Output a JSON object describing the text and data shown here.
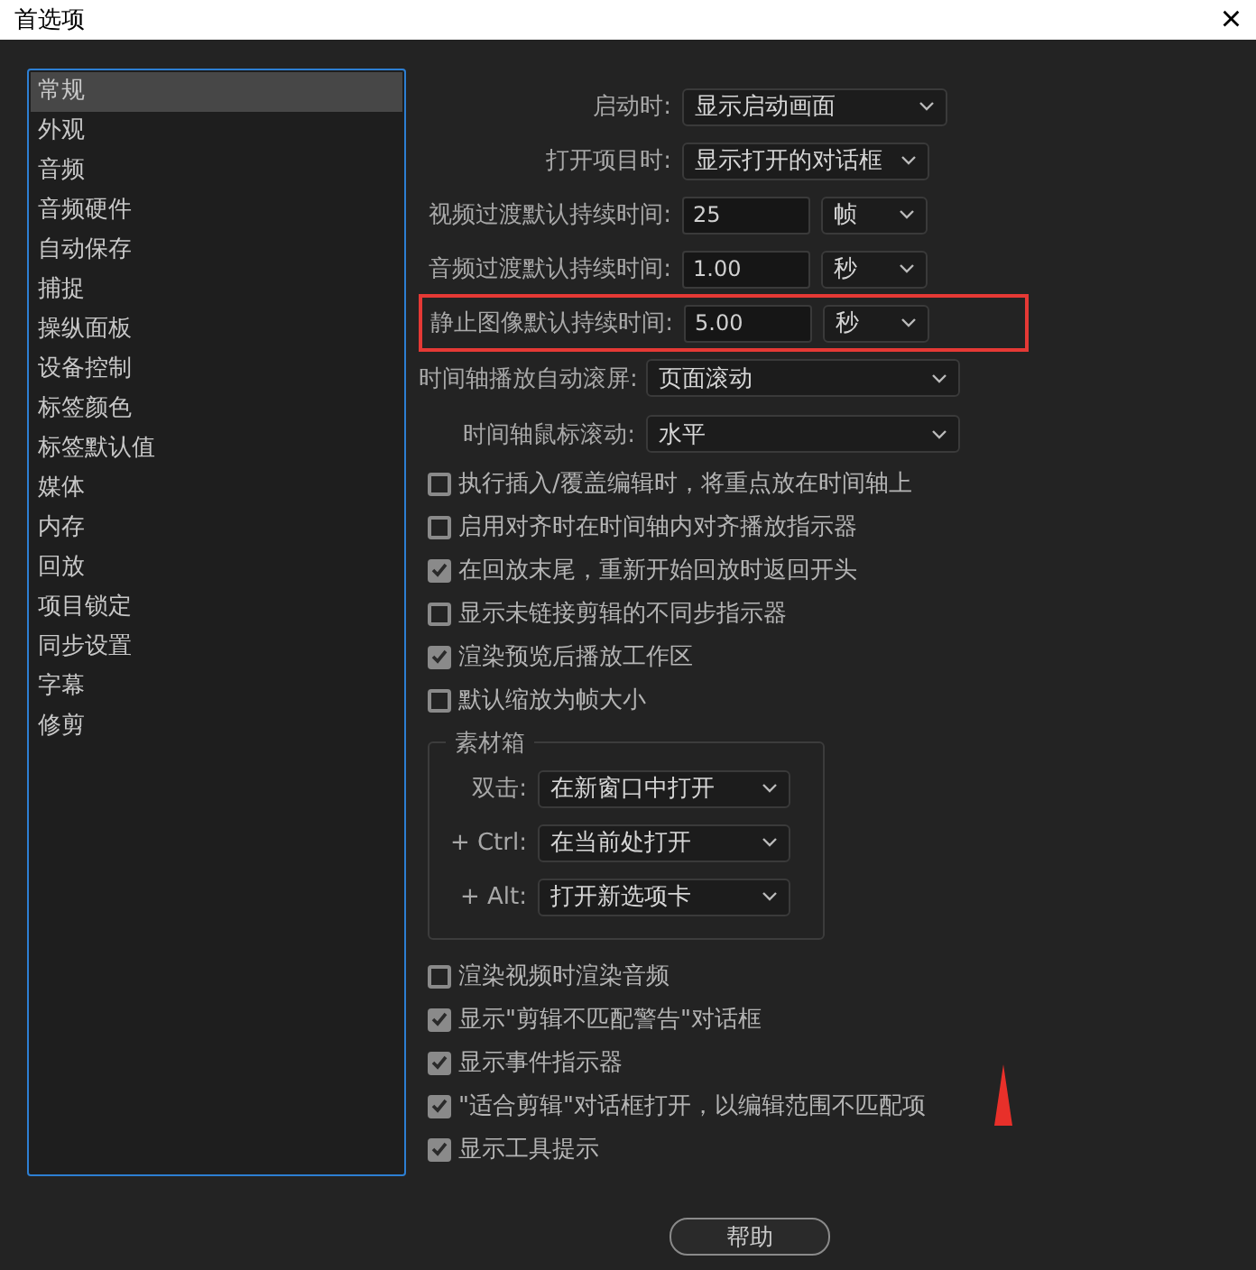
{
  "window": {
    "title": "首选项",
    "close": "×"
  },
  "sidebar": {
    "items": [
      {
        "label": "常规",
        "selected": true
      },
      {
        "label": "外观",
        "selected": false
      },
      {
        "label": "音频",
        "selected": false
      },
      {
        "label": "音频硬件",
        "selected": false
      },
      {
        "label": "自动保存",
        "selected": false
      },
      {
        "label": "捕捉",
        "selected": false
      },
      {
        "label": "操纵面板",
        "selected": false
      },
      {
        "label": "设备控制",
        "selected": false
      },
      {
        "label": "标签颜色",
        "selected": false
      },
      {
        "label": "标签默认值",
        "selected": false
      },
      {
        "label": "媒体",
        "selected": false
      },
      {
        "label": "内存",
        "selected": false
      },
      {
        "label": "回放",
        "selected": false
      },
      {
        "label": "项目锁定",
        "selected": false
      },
      {
        "label": "同步设置",
        "selected": false
      },
      {
        "label": "字幕",
        "selected": false
      },
      {
        "label": "修剪",
        "selected": false
      }
    ]
  },
  "settings": [
    {
      "kind": "select",
      "label": "启动时:",
      "value": "显示启动画面"
    },
    {
      "kind": "select",
      "label": "打开项目时:",
      "value": "显示打开的对话框"
    },
    {
      "kind": "duration",
      "label": "视频过渡默认持续时间:",
      "value": "25",
      "unit": "帧",
      "highlighted": false
    },
    {
      "kind": "duration",
      "label": "音频过渡默认持续时间:",
      "value": "1.00",
      "unit": "秒",
      "highlighted": false
    },
    {
      "kind": "duration",
      "label": "静止图像默认持续时间:",
      "value": "5.00",
      "unit": "秒",
      "highlighted": true
    },
    {
      "kind": "wide",
      "label": "时间轴播放自动滚屏:",
      "value": "页面滚动"
    },
    {
      "kind": "wide",
      "label": "时间轴鼠标滚动:",
      "value": "水平"
    }
  ],
  "options": [
    {
      "label": "执行插入/覆盖编辑时，将重点放在时间轴上",
      "checked": false
    },
    {
      "label": "启用对齐时在时间轴内对齐播放指示器",
      "checked": false
    },
    {
      "label": "在回放末尾，重新开始回放时返回开头",
      "checked": true
    },
    {
      "label": "显示未链接剪辑的不同步指示器",
      "checked": false
    },
    {
      "label": "渲染预览后播放工作区",
      "checked": true
    },
    {
      "label": "默认缩放为帧大小",
      "checked": false
    }
  ],
  "bin": {
    "title": "素材箱",
    "rows": [
      {
        "label": "双击:",
        "value": "在新窗口中打开"
      },
      {
        "label": "+ Ctrl:",
        "value": "在当前处打开"
      },
      {
        "label": "+ Alt:",
        "value": "打开新选项卡"
      }
    ]
  },
  "options_2": [
    {
      "label": "渲染视频时渲染音频",
      "checked": false
    },
    {
      "label": "显示\"剪辑不匹配警告\"对话框",
      "checked": true
    },
    {
      "label": "显示事件指示器",
      "checked": true
    },
    {
      "label": "\"适合剪辑\"对话框打开，以编辑范围不匹配项",
      "checked": true
    },
    {
      "label": "显示工具提示",
      "checked": true
    }
  ],
  "buttons": [
    {
      "label": "帮助"
    }
  ]
}
